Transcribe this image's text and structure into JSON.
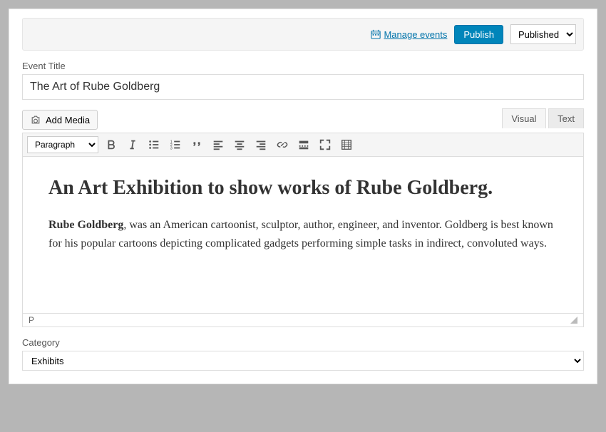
{
  "topbar": {
    "manage_events": "Manage events",
    "publish": "Publish",
    "status": "Published"
  },
  "title": {
    "label": "Event Title",
    "value": "The Art of Rube Goldberg"
  },
  "media": {
    "add": "Add Media"
  },
  "tabs": {
    "visual": "Visual",
    "text": "Text"
  },
  "toolbar": {
    "format": "Paragraph"
  },
  "content": {
    "heading": "An Art Exhibition to show works of Rube Goldberg.",
    "lead": "Rube Goldberg",
    "body": ", was an American cartoonist, sculptor, author, engineer, and inventor. Goldberg is best known for his popular cartoons depicting complicated gadgets performing simple tasks in indirect, convoluted ways."
  },
  "pathbar": "P",
  "category": {
    "label": "Category",
    "value": "Exhibits"
  }
}
